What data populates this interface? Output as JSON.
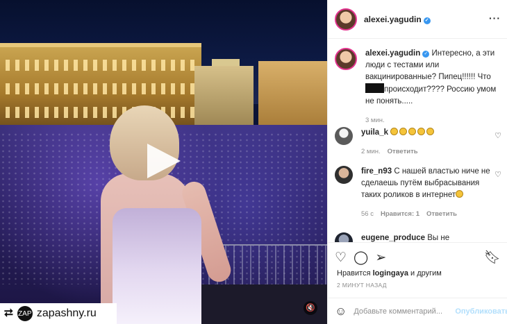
{
  "repost": {
    "icon": "repost-icon",
    "avatar": "ZAP",
    "name": "zapashny.ru"
  },
  "post": {
    "author": "alexei.yagudin",
    "more_icon": "more-icon"
  },
  "comments": [
    {
      "user": "alexei.yagudin",
      "text_before_redaction": "Интересно, а эти люди с тестами или вакцинированные? Пипец!!!!!! Что",
      "text_after_redaction": "происходит???? Россию умом не понять.....",
      "time": "3 мин."
    },
    {
      "user": "yuila_k",
      "emoji_count": 5,
      "time": "2 мин.",
      "reply": "Ответить"
    },
    {
      "user": "fire_n93",
      "text": "С нашей властью ниче не сделаешь путём выбрасывания таких роликов в интернет",
      "time": "56 с",
      "likes": "Нравится: 1",
      "reply": "Ответить"
    },
    {
      "user": "eugene_produce",
      "text": "Вы не"
    }
  ],
  "actions": {
    "likes_prefix": "Нравится",
    "likes_user": "logingaya",
    "likes_suffix": "и другим",
    "timestamp": "2 МИНУТ НАЗАД"
  },
  "composer": {
    "placeholder": "Добавьте комментарий...",
    "publish": "Опубликовать"
  }
}
